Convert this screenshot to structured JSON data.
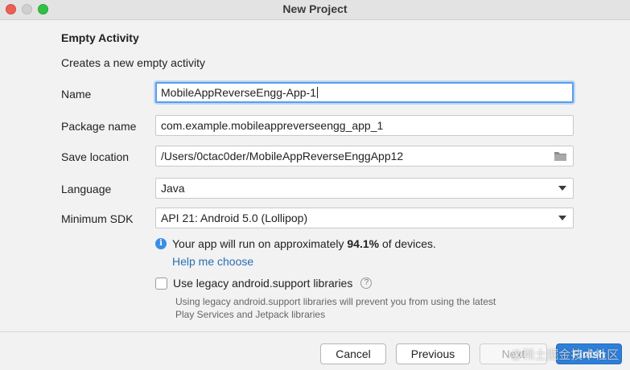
{
  "window": {
    "title": "New Project"
  },
  "template": {
    "heading": "Empty Activity",
    "description": "Creates a new empty activity"
  },
  "form": {
    "name": {
      "label": "Name",
      "value": "MobileAppReverseEngg-App-1"
    },
    "package_name": {
      "label": "Package name",
      "value": "com.example.mobileappreverseengg_app_1"
    },
    "save_location": {
      "label": "Save location",
      "value": "/Users/0ctac0der/MobileAppReverseEnggApp12",
      "icon": "folder-icon"
    },
    "language": {
      "label": "Language",
      "selected": "Java"
    },
    "minimum_sdk": {
      "label": "Minimum SDK",
      "selected": "API 21: Android 5.0 (Lollipop)"
    }
  },
  "info": {
    "icon": "info-icon",
    "prefix": "Your app will run on approximately ",
    "percent": "94.1%",
    "suffix": " of devices.",
    "link": "Help me choose"
  },
  "legacy": {
    "label": "Use legacy android.support libraries",
    "checked": false,
    "help_icon": "?",
    "note": "Using legacy android.support libraries will prevent you from using the latest Play Services and Jetpack libraries"
  },
  "buttons": {
    "cancel": "Cancel",
    "previous": "Previous",
    "next": "Next",
    "finish": "Finish"
  },
  "watermark": "@稀土掘金技术社区",
  "colors": {
    "accent": "#2f7fd8",
    "link": "#2a6db5",
    "focus_ring": "#5a9ee9"
  }
}
